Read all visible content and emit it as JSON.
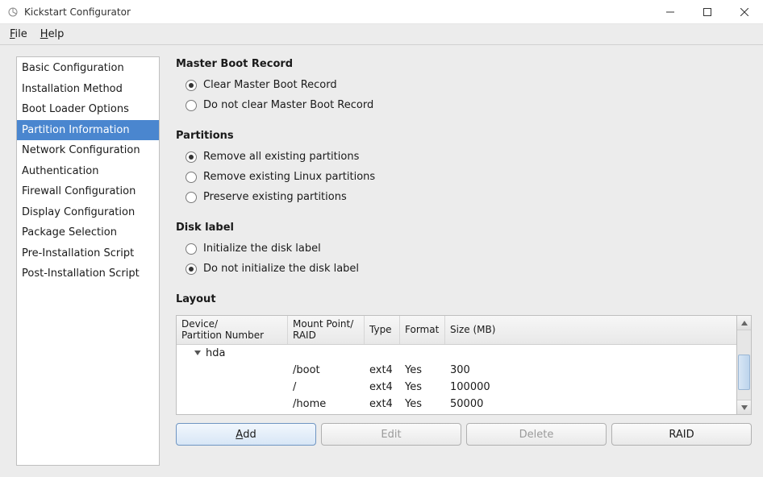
{
  "window": {
    "title": "Kickstart Configurator"
  },
  "menubar": {
    "file": "File",
    "help": "Help"
  },
  "sidebar": {
    "items": [
      {
        "label": "Basic Configuration"
      },
      {
        "label": "Installation Method"
      },
      {
        "label": "Boot Loader Options"
      },
      {
        "label": "Partition Information"
      },
      {
        "label": "Network Configuration"
      },
      {
        "label": "Authentication"
      },
      {
        "label": "Firewall Configuration"
      },
      {
        "label": "Display Configuration"
      },
      {
        "label": "Package Selection"
      },
      {
        "label": "Pre-Installation Script"
      },
      {
        "label": "Post-Installation Script"
      }
    ],
    "selected_index": 3
  },
  "mbr": {
    "title": "Master Boot Record",
    "options": [
      {
        "label": "Clear Master Boot Record",
        "checked": true
      },
      {
        "label": "Do not clear Master Boot Record",
        "checked": false
      }
    ]
  },
  "partitions": {
    "title": "Partitions",
    "options": [
      {
        "label": "Remove all existing partitions",
        "checked": true
      },
      {
        "label": "Remove existing Linux partitions",
        "checked": false
      },
      {
        "label": "Preserve existing partitions",
        "checked": false
      }
    ]
  },
  "disklabel": {
    "title": "Disk label",
    "options": [
      {
        "label": "Initialize the disk label",
        "checked": false
      },
      {
        "label": "Do not initialize the disk label",
        "checked": true
      }
    ]
  },
  "layout": {
    "title": "Layout",
    "headers": {
      "device": "Device/\nPartition Number",
      "mount": "Mount Point/\nRAID",
      "type": "Type",
      "format": "Format",
      "size": "Size (MB)"
    },
    "root_device": "hda",
    "rows": [
      {
        "device": "",
        "mount": "/boot",
        "type": "ext4",
        "format": "Yes",
        "size": "300"
      },
      {
        "device": "",
        "mount": "/",
        "type": "ext4",
        "format": "Yes",
        "size": "100000"
      },
      {
        "device": "",
        "mount": "/home",
        "type": "ext4",
        "format": "Yes",
        "size": "50000"
      }
    ]
  },
  "buttons": {
    "add": "Add",
    "edit": "Edit",
    "delete": "Delete",
    "raid": "RAID"
  }
}
